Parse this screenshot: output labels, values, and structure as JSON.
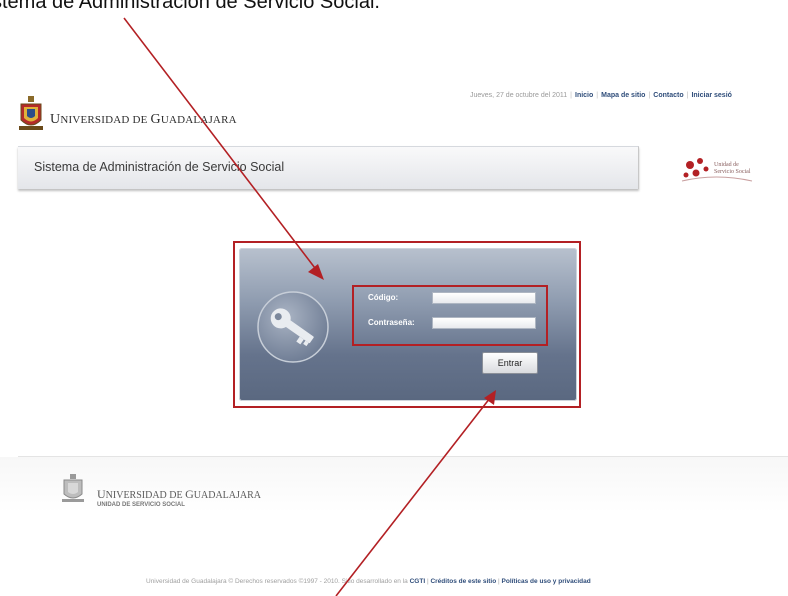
{
  "caption": "stema de Administración de Servicio Social.",
  "header": {
    "date": "Jueves, 27 de octubre del 2011",
    "links": [
      "Inicio",
      "Mapa de sitio",
      "Contacto",
      "Iniciar sesió"
    ]
  },
  "brand": {
    "name_first": "U",
    "name_rest": "NIVERSIDAD DE ",
    "name_second": "G",
    "name_end": "UADALAJARA"
  },
  "title_bar": {
    "title": "Sistema de Administración de Servicio Social"
  },
  "ss_logo": {
    "line1": "Unidad de",
    "line2": "Servicio Social"
  },
  "login": {
    "codigo_label": "Código:",
    "codigo_value": "",
    "password_label": "Contraseña:",
    "password_value": "",
    "submit_label": "Entrar"
  },
  "footer": {
    "name_first": "U",
    "name_rest": "NIVERSIDAD DE ",
    "name_second": "G",
    "name_end": "UADALAJARA",
    "unit": "UNIDAD DE SERVICIO SOCIAL",
    "copyright": "Universidad de Guadalajara © Derechos reservados ©1997 - 2010. Sitio desarrollado en la",
    "cgti": "CGTI",
    "credits": "Créditos de este sitio",
    "privacy": "Políticas de uso y privacidad"
  },
  "colors": {
    "annotation_red": "#b32024",
    "link_blue": "#2f4d7a",
    "panel_top": "#b8c1ce",
    "panel_bottom": "#5a6880"
  }
}
